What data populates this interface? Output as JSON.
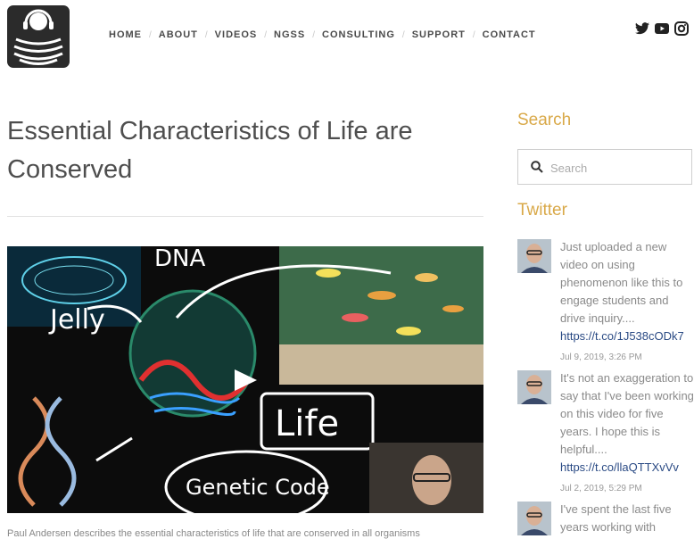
{
  "header": {
    "nav": [
      "HOME",
      "ABOUT",
      "VIDEOS",
      "NGSS",
      "CONSULTING",
      "SUPPORT",
      "CONTACT"
    ],
    "social_icons": [
      "twitter-icon",
      "youtube-icon",
      "instagram-icon"
    ]
  },
  "post": {
    "title": "Essential Characteristics of Life are Conserved",
    "video": {
      "labels": [
        "DNA",
        "Jelly",
        "Life",
        "Genetic Code"
      ]
    },
    "caption": "Paul Andersen describes the essential characteristics of life that are conserved in all organisms"
  },
  "sidebar": {
    "search_heading": "Search",
    "search_placeholder": "Search",
    "twitter_heading": "Twitter",
    "tweets": [
      {
        "text": "Just uploaded a new video on using phenomenon like this to engage students and drive inquiry....",
        "link": "https://t.co/1J538cODk7",
        "date": "Jul 9, 2019, 3:26 PM"
      },
      {
        "text": "It's not an exaggeration to say that I've been working on this video for five years. I hope this is helpful....",
        "link": "https://t.co/llaQTTXvVv",
        "date": "Jul 2, 2019, 5:29 PM"
      },
      {
        "text": "I've spent the last five years working with",
        "link": "",
        "date": ""
      }
    ]
  },
  "colors": {
    "accent": "#d9a949",
    "link": "#2a4a84",
    "text": "#8a8a8a",
    "logo_bg": "#2b2b2b"
  }
}
